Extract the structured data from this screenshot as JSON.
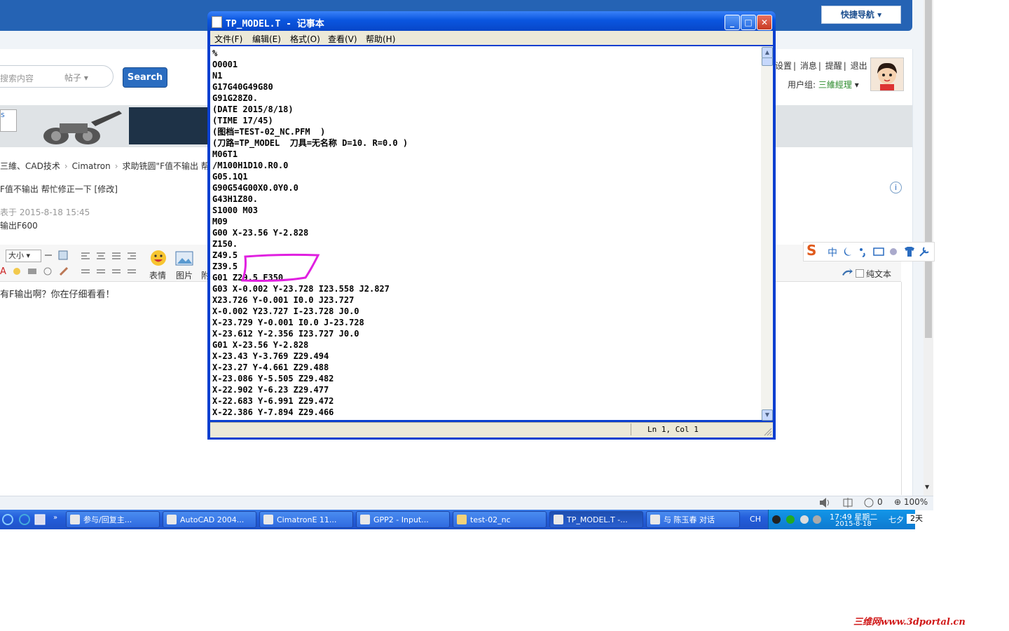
{
  "browser": {
    "quick_nav": "快捷导航",
    "search_placeholder": "搜索内容",
    "search_type": "帖子",
    "search_button": "Search",
    "user_links": [
      "设置",
      "消息",
      "提醒",
      "退出"
    ],
    "user_group_label": "用户组:",
    "user_group_value": "三維經理",
    "banner_box": "s",
    "breadcrumb": [
      "三維、CAD技术",
      "Cimatron",
      "求助铣圆\"F值不输出 帮"
    ],
    "post_line1": "F值不输出 帮忙修正一下 [修改]",
    "post_line2": "表于 2015-8-18 15:45",
    "post_line3": "输出F600",
    "editor": {
      "size_select": "大小",
      "emotion_label": "表情",
      "image_label": "图片",
      "attach_label": "附",
      "plain_text_label": "纯文本"
    },
    "reply_text": "有F输出啊？你在仔细看看！",
    "status_zoom": "100%",
    "status_count": "0"
  },
  "ime": {
    "logo": "S",
    "mode": "中"
  },
  "notepad": {
    "title": "TP_MODEL.T - 记事本",
    "menu": [
      "文件(F)",
      "编辑(E)",
      "格式(O)",
      "查看(V)",
      "帮助(H)"
    ],
    "lines": [
      "%",
      "O0001",
      "N1",
      "G17G40G49G80",
      "G91G28Z0.",
      "(DATE 2015/8/18)",
      "(TIME 17/45)",
      "(图档=TEST-02_NC.PFM  )",
      "(刀路=TP_MODEL  刀具=无名称 D=10. R=0.0 )",
      "M06T1",
      "/M100H1D10.R0.0",
      "G05.1Q1",
      "G90G54G00X0.0Y0.0",
      "G43H1Z80.",
      "S1000 M03",
      "M09",
      "G00 X-23.56 Y-2.828",
      "Z150.",
      "Z49.5",
      "Z39.5",
      "G01 Z29.5 F350",
      "G03 X-0.002 Y-23.728 I23.558 J2.827",
      "X23.726 Y-0.001 I0.0 J23.727",
      "X-0.002 Y23.727 I-23.728 J0.0",
      "X-23.729 Y-0.001 I0.0 J-23.728",
      "X-23.612 Y-2.356 I23.727 J0.0",
      "G01 X-23.56 Y-2.828",
      "X-23.43 Y-3.769 Z29.494",
      "X-23.27 Y-4.661 Z29.488",
      "X-23.086 Y-5.505 Z29.482",
      "X-22.902 Y-6.23 Z29.477",
      "X-22.683 Y-6.991 Z29.472",
      "X-22.386 Y-7.894 Z29.466"
    ],
    "status": "Ln 1, Col 1"
  },
  "taskbar": {
    "items": [
      "参与/回复主...",
      "AutoCAD 2004...",
      "CimatronE 11...",
      "GPP2 - Input...",
      "test-02_nc",
      "TP_MODEL.T -...",
      "与 陈玉春 对话"
    ],
    "lang": "CH",
    "time": "17:49 星期二",
    "date": "2015-8-18",
    "festival": "七夕",
    "festival_days": "2天"
  },
  "watermark": "三维网www.3dportal.cn",
  "colors": {
    "markup": "#e020e0",
    "title_bar": "#0a56e0",
    "taskbar": "#245edb"
  }
}
